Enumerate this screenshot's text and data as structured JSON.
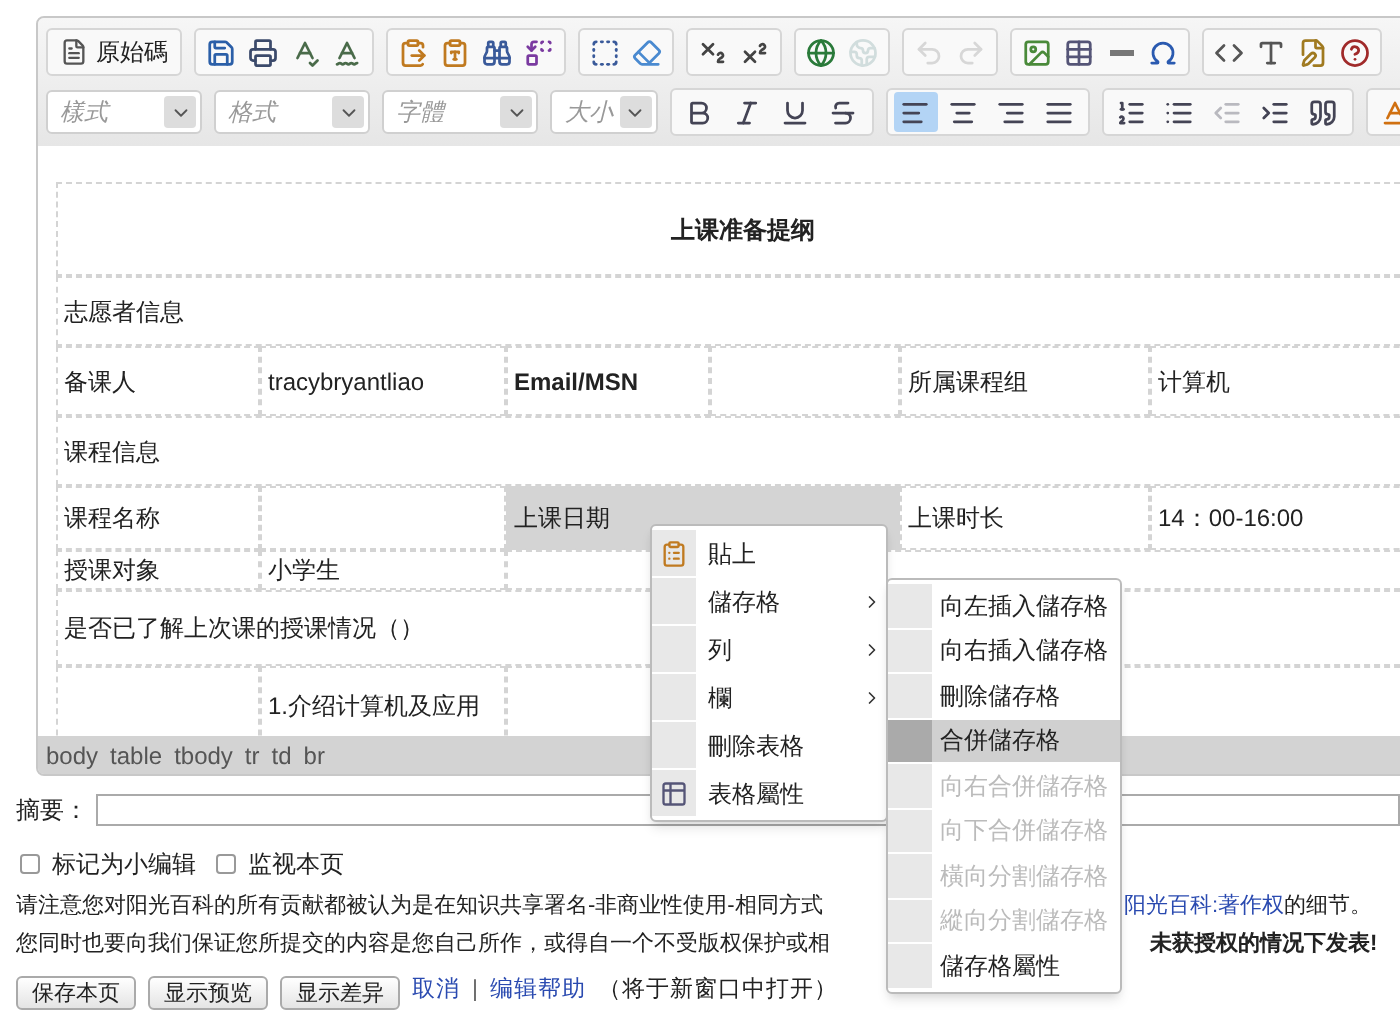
{
  "toolbar": {
    "source_button": "原始碼",
    "row_1": [
      {
        "disabled": false
      },
      {
        "disabled": false
      },
      {
        "disabled": false
      },
      {
        "disabled": false
      },
      {
        "disabled": false
      },
      {
        "disabled": false
      },
      {
        "disabled": false
      },
      {
        "disabled": false
      },
      {
        "disabled": false
      },
      {
        "disabled": false
      },
      {
        "disabled": false
      },
      {
        "disabled": false
      },
      {
        "disabled": false
      },
      {
        "disabled": true
      },
      {
        "disabled": true
      },
      {
        "disabled": true
      },
      {
        "disabled": false
      },
      {
        "disabled": false
      },
      {
        "disabled": false
      },
      {
        "disabled": false
      },
      {
        "disabled": false
      },
      {
        "disabled": false
      },
      {
        "disabled": false
      },
      {
        "disabled": false
      }
    ],
    "combos": [
      {
        "placeholder": "樣式"
      },
      {
        "placeholder": "格式"
      },
      {
        "placeholder": "字體"
      },
      {
        "placeholder": "大小"
      }
    ],
    "row_2": [
      {
        "selected": false,
        "disabled": false
      },
      {
        "selected": false,
        "disabled": false
      },
      {
        "selected": false,
        "disabled": false
      },
      {
        "selected": false,
        "disabled": false
      },
      {
        "selected": true,
        "disabled": false
      },
      {
        "selected": false,
        "disabled": false
      },
      {
        "selected": false,
        "disabled": false
      },
      {
        "selected": false,
        "disabled": false
      },
      {
        "selected": false,
        "disabled": false
      },
      {
        "selected": false,
        "disabled": false
      },
      {
        "selected": false,
        "disabled": true
      },
      {
        "selected": false,
        "disabled": false
      },
      {
        "selected": false,
        "disabled": false
      },
      {
        "selected": false,
        "disabled": false
      }
    ]
  },
  "table": {
    "rows": [
      {
        "kind": "title",
        "cells": [
          {
            "text": "上课准备提纲",
            "bold": true,
            "selected": false
          }
        ]
      },
      {
        "kind": "section",
        "cells": [
          {
            "text": "志愿者信息",
            "bold": false,
            "selected": false
          }
        ]
      },
      {
        "kind": "cells",
        "cells": [
          {
            "text": "备课人",
            "bold": false,
            "selected": false
          },
          {
            "text": "tracybryantliao",
            "bold": false,
            "selected": false
          },
          {
            "text": "Email/MSN",
            "bold": true,
            "selected": false
          },
          {
            "selected": false
          },
          {
            "text": "所属课程组",
            "bold": false,
            "selected": false
          },
          {
            "text": "计算机",
            "bold": false,
            "selected": false
          }
        ]
      },
      {
        "kind": "section",
        "cells": [
          {
            "text": "课程信息",
            "bold": false,
            "selected": false
          }
        ]
      },
      {
        "kind": "cells",
        "cells": [
          {
            "text": "课程名称",
            "bold": false,
            "selected": false
          },
          {
            "selected": false
          },
          {
            "text": "上课日期",
            "bold": false,
            "selected": true
          },
          {
            "selected": true
          },
          {
            "text": "上课时长",
            "bold": false,
            "selected": false
          },
          {
            "text": "14：00-16:00",
            "bold": false,
            "selected": false
          }
        ]
      },
      {
        "kind": "cells",
        "cells": [
          {
            "text": "授课对象",
            "bold": false,
            "selected": false
          },
          {
            "text": "小学生",
            "bold": false,
            "selected": false
          }
        ]
      },
      {
        "kind": "section",
        "cells": [
          {
            "text": "是否已了解上次课的授课情况（）",
            "bold": false,
            "selected": false
          }
        ]
      },
      {
        "kind": "cells",
        "cells": [
          {
            "selected": false
          },
          {
            "text": "1.介绍计算机及应用",
            "bold": false,
            "selected": false
          }
        ]
      }
    ],
    "path": [
      "body",
      "table",
      "tbody",
      "tr",
      "td",
      "br"
    ]
  },
  "context_menu": {
    "items": [
      {
        "label": "貼上",
        "kind": "paste",
        "submenu": false,
        "selected": false
      },
      {
        "label": "儲存格",
        "kind": "plain",
        "submenu": true,
        "selected": false
      },
      {
        "label": "列",
        "kind": "plain",
        "submenu": true,
        "selected": false
      },
      {
        "label": "欄",
        "kind": "plain",
        "submenu": true,
        "selected": false
      },
      {
        "label": "刪除表格",
        "kind": "plain",
        "submenu": false,
        "selected": false
      },
      {
        "label": "表格屬性",
        "kind": "table",
        "submenu": false,
        "selected": false
      }
    ]
  },
  "submenu": {
    "items": [
      {
        "label": "向左插入儲存格",
        "disabled": false,
        "selected": false
      },
      {
        "label": "向右插入儲存格",
        "disabled": false,
        "selected": false
      },
      {
        "label": "刪除儲存格",
        "disabled": false,
        "selected": false
      },
      {
        "label": "合併儲存格",
        "disabled": false,
        "selected": true
      },
      {
        "label": "向右合併儲存格",
        "disabled": true,
        "selected": false
      },
      {
        "label": "向下合併儲存格",
        "disabled": true,
        "selected": false
      },
      {
        "label": "橫向分割儲存格",
        "disabled": true,
        "selected": false
      },
      {
        "label": "縱向分割儲存格",
        "disabled": true,
        "selected": false
      },
      {
        "label": "儲存格屬性",
        "disabled": false,
        "selected": false
      }
    ]
  },
  "summary": {
    "label": "摘要："
  },
  "options": [
    {
      "label": "标记为小编辑",
      "checked": false
    },
    {
      "label": "监视本页",
      "checked": false
    }
  ],
  "notice": {
    "line_1_start": "请注意您对阳光百科的所有贡献都被认为是在知识共享署名-非商业性使用-相同方式",
    "line_1_link": "阳光百科:著作权",
    "line_1_end": "的细节。",
    "line_2_start": "您同时也要向我们保证您所提交的内容是您自己所作，或得自一个不受版权保护或相",
    "line_2_end": "未获授权的情况下发表!"
  },
  "actions": {
    "buttons": [
      "保存本页",
      "显示预览",
      "显示差异"
    ],
    "links": [
      "取消",
      "编辑帮助"
    ],
    "separator": "|",
    "note": "（将于新窗口中打开）"
  }
}
